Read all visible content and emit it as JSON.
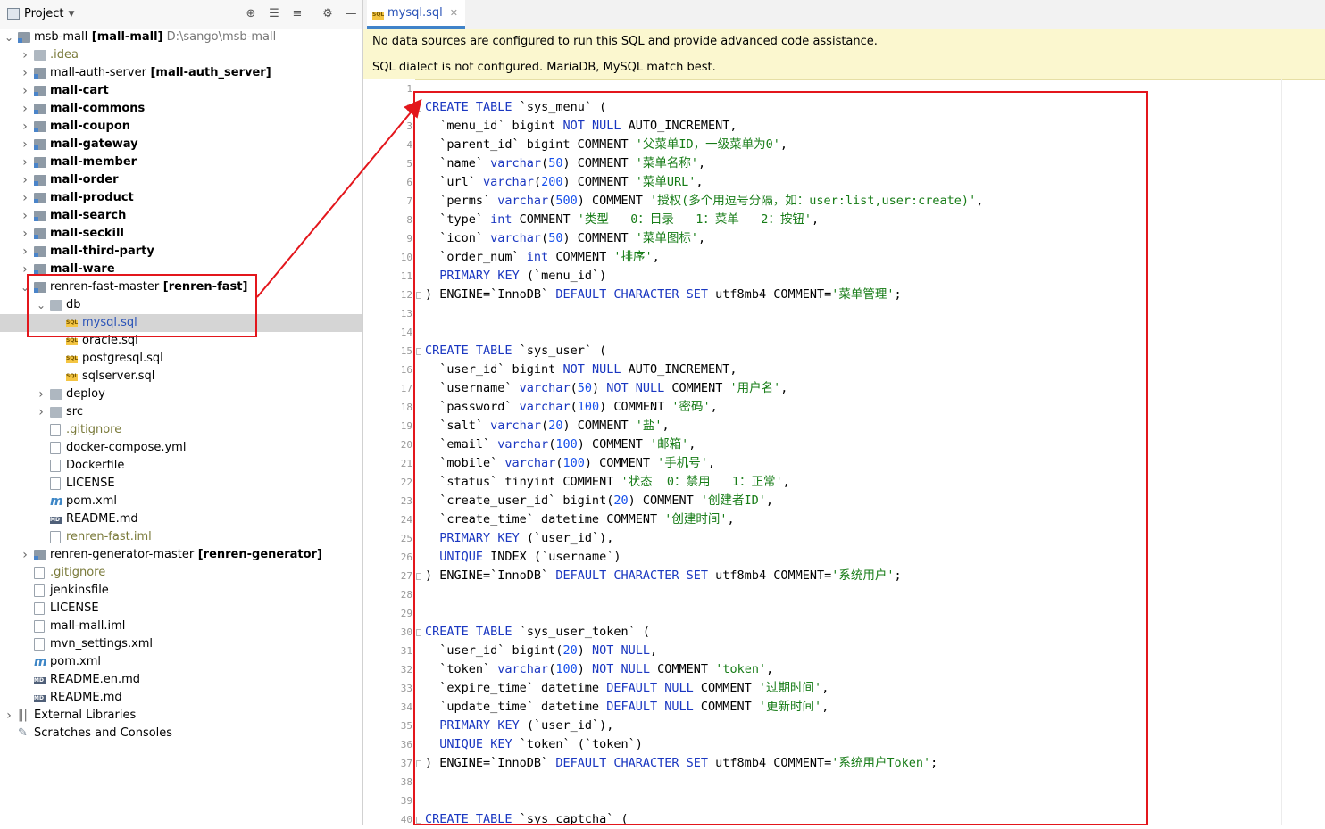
{
  "project_panel": {
    "title": "Project",
    "tree": [
      {
        "name": "msb-mall",
        "suffix": " [mall-mall]",
        "path": "D:\\sango\\msb-mall",
        "depth": 0,
        "open": true,
        "type": "module"
      },
      {
        "name": ".idea",
        "depth": 1,
        "type": "folder",
        "style": "olive"
      },
      {
        "name": "mall-auth-server",
        "suffix": " [mall-auth_server]",
        "depth": 1,
        "type": "module"
      },
      {
        "name": "mall-cart",
        "depth": 1,
        "type": "module",
        "style": "bold"
      },
      {
        "name": "mall-commons",
        "depth": 1,
        "type": "module",
        "style": "bold"
      },
      {
        "name": "mall-coupon",
        "depth": 1,
        "type": "module",
        "style": "bold"
      },
      {
        "name": "mall-gateway",
        "depth": 1,
        "type": "module",
        "style": "bold"
      },
      {
        "name": "mall-member",
        "depth": 1,
        "type": "module",
        "style": "bold"
      },
      {
        "name": "mall-order",
        "depth": 1,
        "type": "module",
        "style": "bold"
      },
      {
        "name": "mall-product",
        "depth": 1,
        "type": "module",
        "style": "bold"
      },
      {
        "name": "mall-search",
        "depth": 1,
        "type": "module",
        "style": "bold"
      },
      {
        "name": "mall-seckill",
        "depth": 1,
        "type": "module",
        "style": "bold"
      },
      {
        "name": "mall-third-party",
        "depth": 1,
        "type": "module",
        "style": "bold"
      },
      {
        "name": "mall-ware",
        "depth": 1,
        "type": "module",
        "style": "bold"
      },
      {
        "name": "renren-fast-master",
        "suffix": " [renren-fast]",
        "depth": 1,
        "open": true,
        "type": "module"
      },
      {
        "name": "db",
        "depth": 2,
        "open": true,
        "type": "folder"
      },
      {
        "name": "mysql.sql",
        "depth": 3,
        "type": "sql",
        "selected": true,
        "style": "blue"
      },
      {
        "name": "oracle.sql",
        "depth": 3,
        "type": "sql"
      },
      {
        "name": "postgresql.sql",
        "depth": 3,
        "type": "sql"
      },
      {
        "name": "sqlserver.sql",
        "depth": 3,
        "type": "sql"
      },
      {
        "name": "deploy",
        "depth": 2,
        "type": "folder"
      },
      {
        "name": "src",
        "depth": 2,
        "type": "folder"
      },
      {
        "name": ".gitignore",
        "depth": 2,
        "type": "file",
        "style": "olive"
      },
      {
        "name": "docker-compose.yml",
        "depth": 2,
        "type": "file"
      },
      {
        "name": "Dockerfile",
        "depth": 2,
        "type": "file"
      },
      {
        "name": "LICENSE",
        "depth": 2,
        "type": "file"
      },
      {
        "name": "pom.xml",
        "depth": 2,
        "type": "maven"
      },
      {
        "name": "README.md",
        "depth": 2,
        "type": "md"
      },
      {
        "name": "renren-fast.iml",
        "depth": 2,
        "type": "file",
        "style": "olive"
      },
      {
        "name": "renren-generator-master",
        "suffix": " [renren-generator]",
        "depth": 1,
        "type": "module"
      },
      {
        "name": ".gitignore",
        "depth": 1,
        "type": "file",
        "style": "olive"
      },
      {
        "name": "jenkinsfile",
        "depth": 1,
        "type": "file"
      },
      {
        "name": "LICENSE",
        "depth": 1,
        "type": "file"
      },
      {
        "name": "mall-mall.iml",
        "depth": 1,
        "type": "file"
      },
      {
        "name": "mvn_settings.xml",
        "depth": 1,
        "type": "file"
      },
      {
        "name": "pom.xml",
        "depth": 1,
        "type": "maven"
      },
      {
        "name": "README.en.md",
        "depth": 1,
        "type": "md"
      },
      {
        "name": "README.md",
        "depth": 1,
        "type": "md"
      },
      {
        "name": "External Libraries",
        "depth": 0,
        "type": "libs"
      },
      {
        "name": "Scratches and Consoles",
        "depth": 0,
        "type": "scratch"
      }
    ]
  },
  "editor": {
    "tab_label": "mysql.sql",
    "banner_datasource": "No data sources are configured to run this SQL and provide advanced code assistance.",
    "banner_dialect": "SQL dialect is not configured. MariaDB, MySQL match best.",
    "lines": [
      "",
      "CREATE TABLE `sys_menu` (",
      "  `menu_id` bigint NOT NULL AUTO_INCREMENT,",
      "  `parent_id` bigint COMMENT '父菜单ID，一级菜单为0',",
      "  `name` varchar(50) COMMENT '菜单名称',",
      "  `url` varchar(200) COMMENT '菜单URL',",
      "  `perms` varchar(500) COMMENT '授权(多个用逗号分隔，如：user:list,user:create)',",
      "  `type` int COMMENT '类型   0：目录   1：菜单   2：按钮',",
      "  `icon` varchar(50) COMMENT '菜单图标',",
      "  `order_num` int COMMENT '排序',",
      "  PRIMARY KEY (`menu_id`)",
      ") ENGINE=`InnoDB` DEFAULT CHARACTER SET utf8mb4 COMMENT='菜单管理';",
      "",
      "",
      "CREATE TABLE `sys_user` (",
      "  `user_id` bigint NOT NULL AUTO_INCREMENT,",
      "  `username` varchar(50) NOT NULL COMMENT '用户名',",
      "  `password` varchar(100) COMMENT '密码',",
      "  `salt` varchar(20) COMMENT '盐',",
      "  `email` varchar(100) COMMENT '邮箱',",
      "  `mobile` varchar(100) COMMENT '手机号',",
      "  `status` tinyint COMMENT '状态  0：禁用   1：正常',",
      "  `create_user_id` bigint(20) COMMENT '创建者ID',",
      "  `create_time` datetime COMMENT '创建时间',",
      "  PRIMARY KEY (`user_id`),",
      "  UNIQUE INDEX (`username`)",
      ") ENGINE=`InnoDB` DEFAULT CHARACTER SET utf8mb4 COMMENT='系统用户';",
      "",
      "",
      "CREATE TABLE `sys_user_token` (",
      "  `user_id` bigint(20) NOT NULL,",
      "  `token` varchar(100) NOT NULL COMMENT 'token',",
      "  `expire_time` datetime DEFAULT NULL COMMENT '过期时间',",
      "  `update_time` datetime DEFAULT NULL COMMENT '更新时间',",
      "  PRIMARY KEY (`user_id`),",
      "  UNIQUE KEY `token` (`token`)",
      ") ENGINE=`InnoDB` DEFAULT CHARACTER SET utf8mb4 COMMENT='系统用户Token';",
      "",
      "",
      "CREATE TABLE `sys_captcha` ("
    ]
  },
  "colors": {
    "keyword": "#1a37c1",
    "string": "#177c17",
    "number": "#1750eb",
    "annotation": "#e3161c",
    "banner": "#fbf7cf",
    "selection": "#d5d5d5"
  }
}
